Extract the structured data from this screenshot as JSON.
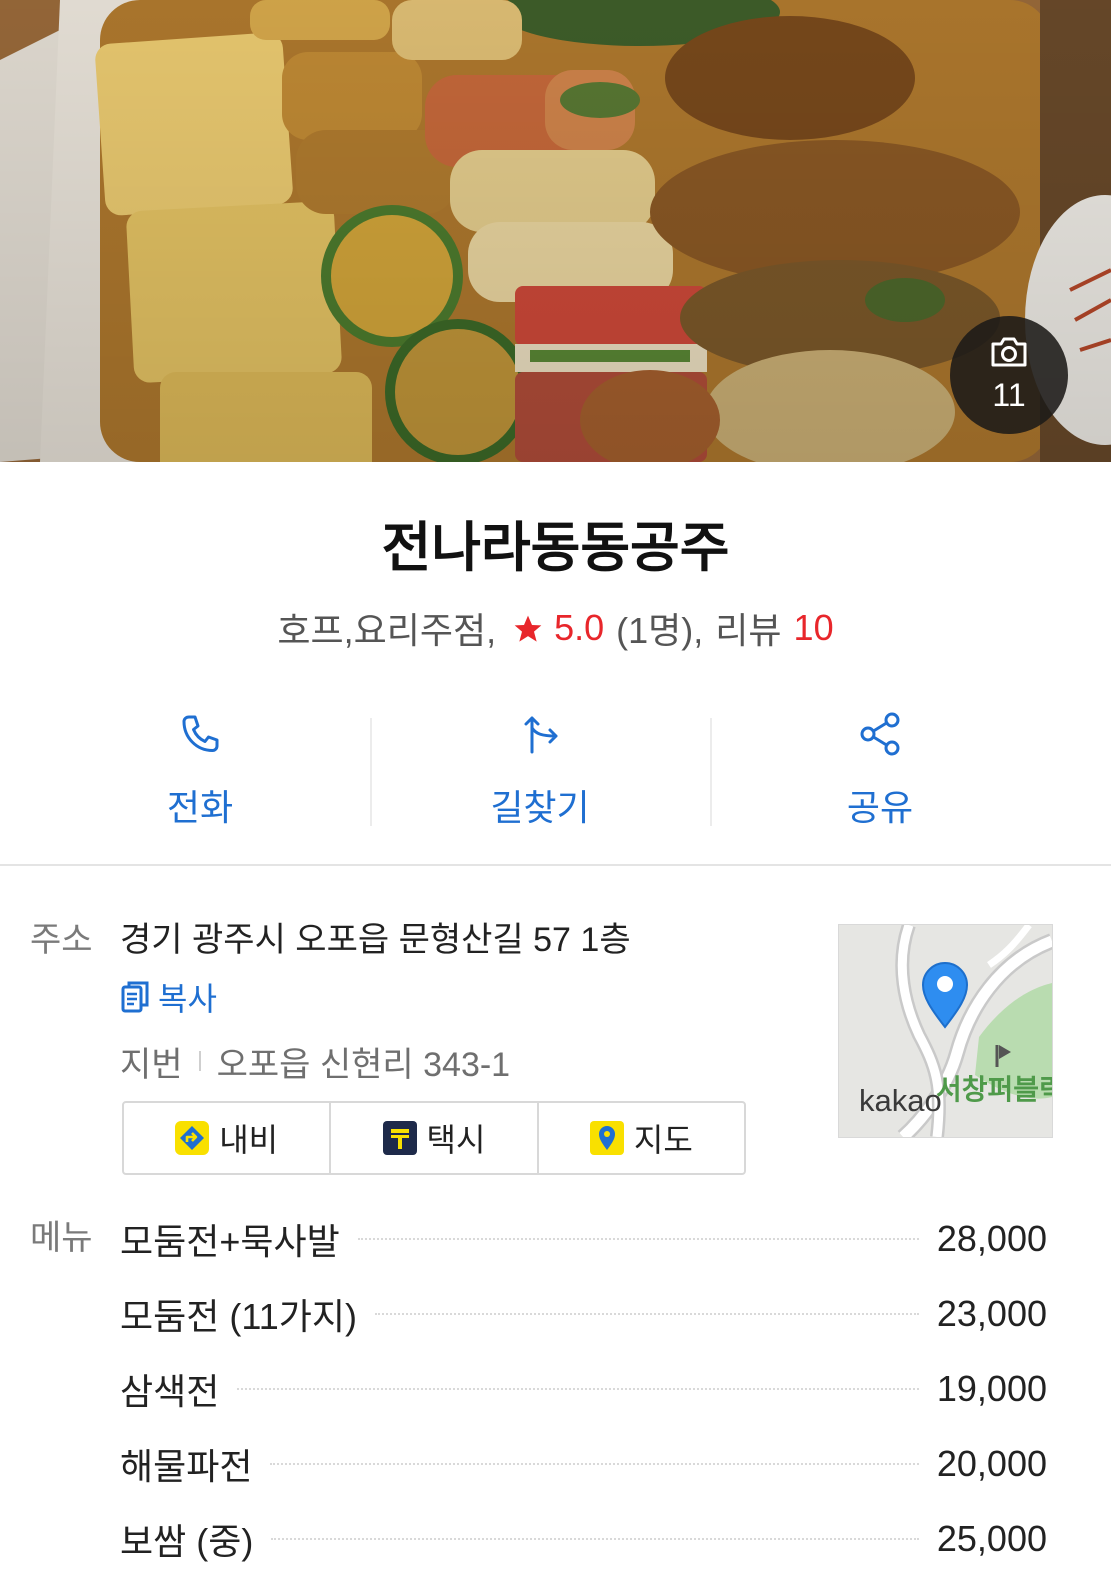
{
  "hero": {
    "photo_count": "11",
    "icon": "camera-icon"
  },
  "place": {
    "name": "전나라동동공주",
    "category": "호프,요리주점,",
    "rating": "5.0",
    "rating_count": "(1명),",
    "review_label": "리뷰",
    "review_count": "10"
  },
  "actions": [
    {
      "label": "전화",
      "icon": "phone-icon"
    },
    {
      "label": "길찾기",
      "icon": "directions-icon"
    },
    {
      "label": "공유",
      "icon": "share-icon"
    }
  ],
  "address": {
    "label": "주소",
    "value": "경기 광주시 오포읍 문형산길 57 1층",
    "copy_label": "복사",
    "jibun_label": "지번",
    "jibun_value": "오포읍 신현리 343-1"
  },
  "nav_buttons": [
    {
      "label": "내비",
      "icon": "navi-icon"
    },
    {
      "label": "택시",
      "icon": "taxi-icon"
    },
    {
      "label": "지도",
      "icon": "map-pin-icon"
    }
  ],
  "map": {
    "brand": "kakao",
    "poi": "서창퍼블릭"
  },
  "menu": {
    "label": "메뉴",
    "items": [
      {
        "name": "모둠전+묵사발",
        "price": "28,000"
      },
      {
        "name": "모둠전 (11가지)",
        "price": "23,000"
      },
      {
        "name": "삼색전",
        "price": "19,000"
      },
      {
        "name": "해물파전",
        "price": "20,000"
      },
      {
        "name": "보쌈 (중)",
        "price": "25,000"
      }
    ]
  },
  "colors": {
    "accent": "#1f6fd1",
    "rating": "#e8262b",
    "text": "#222222",
    "muted": "#6f6f6f",
    "kakao_yellow": "#f9e000"
  }
}
